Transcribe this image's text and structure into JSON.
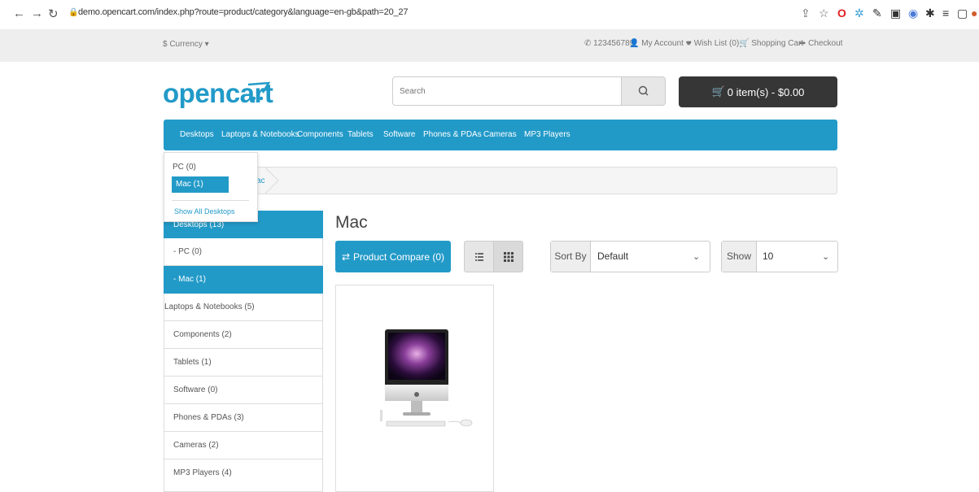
{
  "browser": {
    "url": "demo.opencart.com/index.php?route=product/category&language=en-gb&path=20_27",
    "back_icon": "arrow-left-icon",
    "forward_icon": "arrow-right-icon",
    "reload_icon": "reload-icon"
  },
  "topbar": {
    "currency": "$ Currency ▾",
    "phone": "123456789",
    "account": "My Account ▾",
    "wishlist": "Wish List (0)",
    "cart": "Shopping Cart",
    "checkout": "Checkout"
  },
  "header": {
    "logo_text": "opencart",
    "search_placeholder": "Search",
    "cart_button": "0 item(s) - $0.00"
  },
  "menu": [
    "Desktops",
    "Laptops & Notebooks",
    "Components",
    "Tablets",
    "Software",
    "Phones & PDAs",
    "Cameras",
    "MP3 Players"
  ],
  "dropdown": {
    "items": [
      "PC (0)",
      "Mac (1)"
    ],
    "show_all": "Show All Desktops"
  },
  "breadcrumb": {
    "partial": "ac"
  },
  "sidebar": {
    "items": [
      "Desktops (13)",
      "- PC (0)",
      "- Mac (1)",
      "Laptops & Notebooks (5)",
      "Components (2)",
      "Tablets (1)",
      "Software (0)",
      "Phones & PDAs (3)",
      "Cameras (2)",
      "MP3 Players (4)"
    ]
  },
  "content": {
    "title": "Mac",
    "compare_button": "Product Compare (0)",
    "sort_label": "Sort By",
    "sort_value": "Default",
    "show_label": "Show",
    "show_value": "10"
  },
  "colors": {
    "brand": "#229ac8",
    "cart_button": "#363636"
  }
}
